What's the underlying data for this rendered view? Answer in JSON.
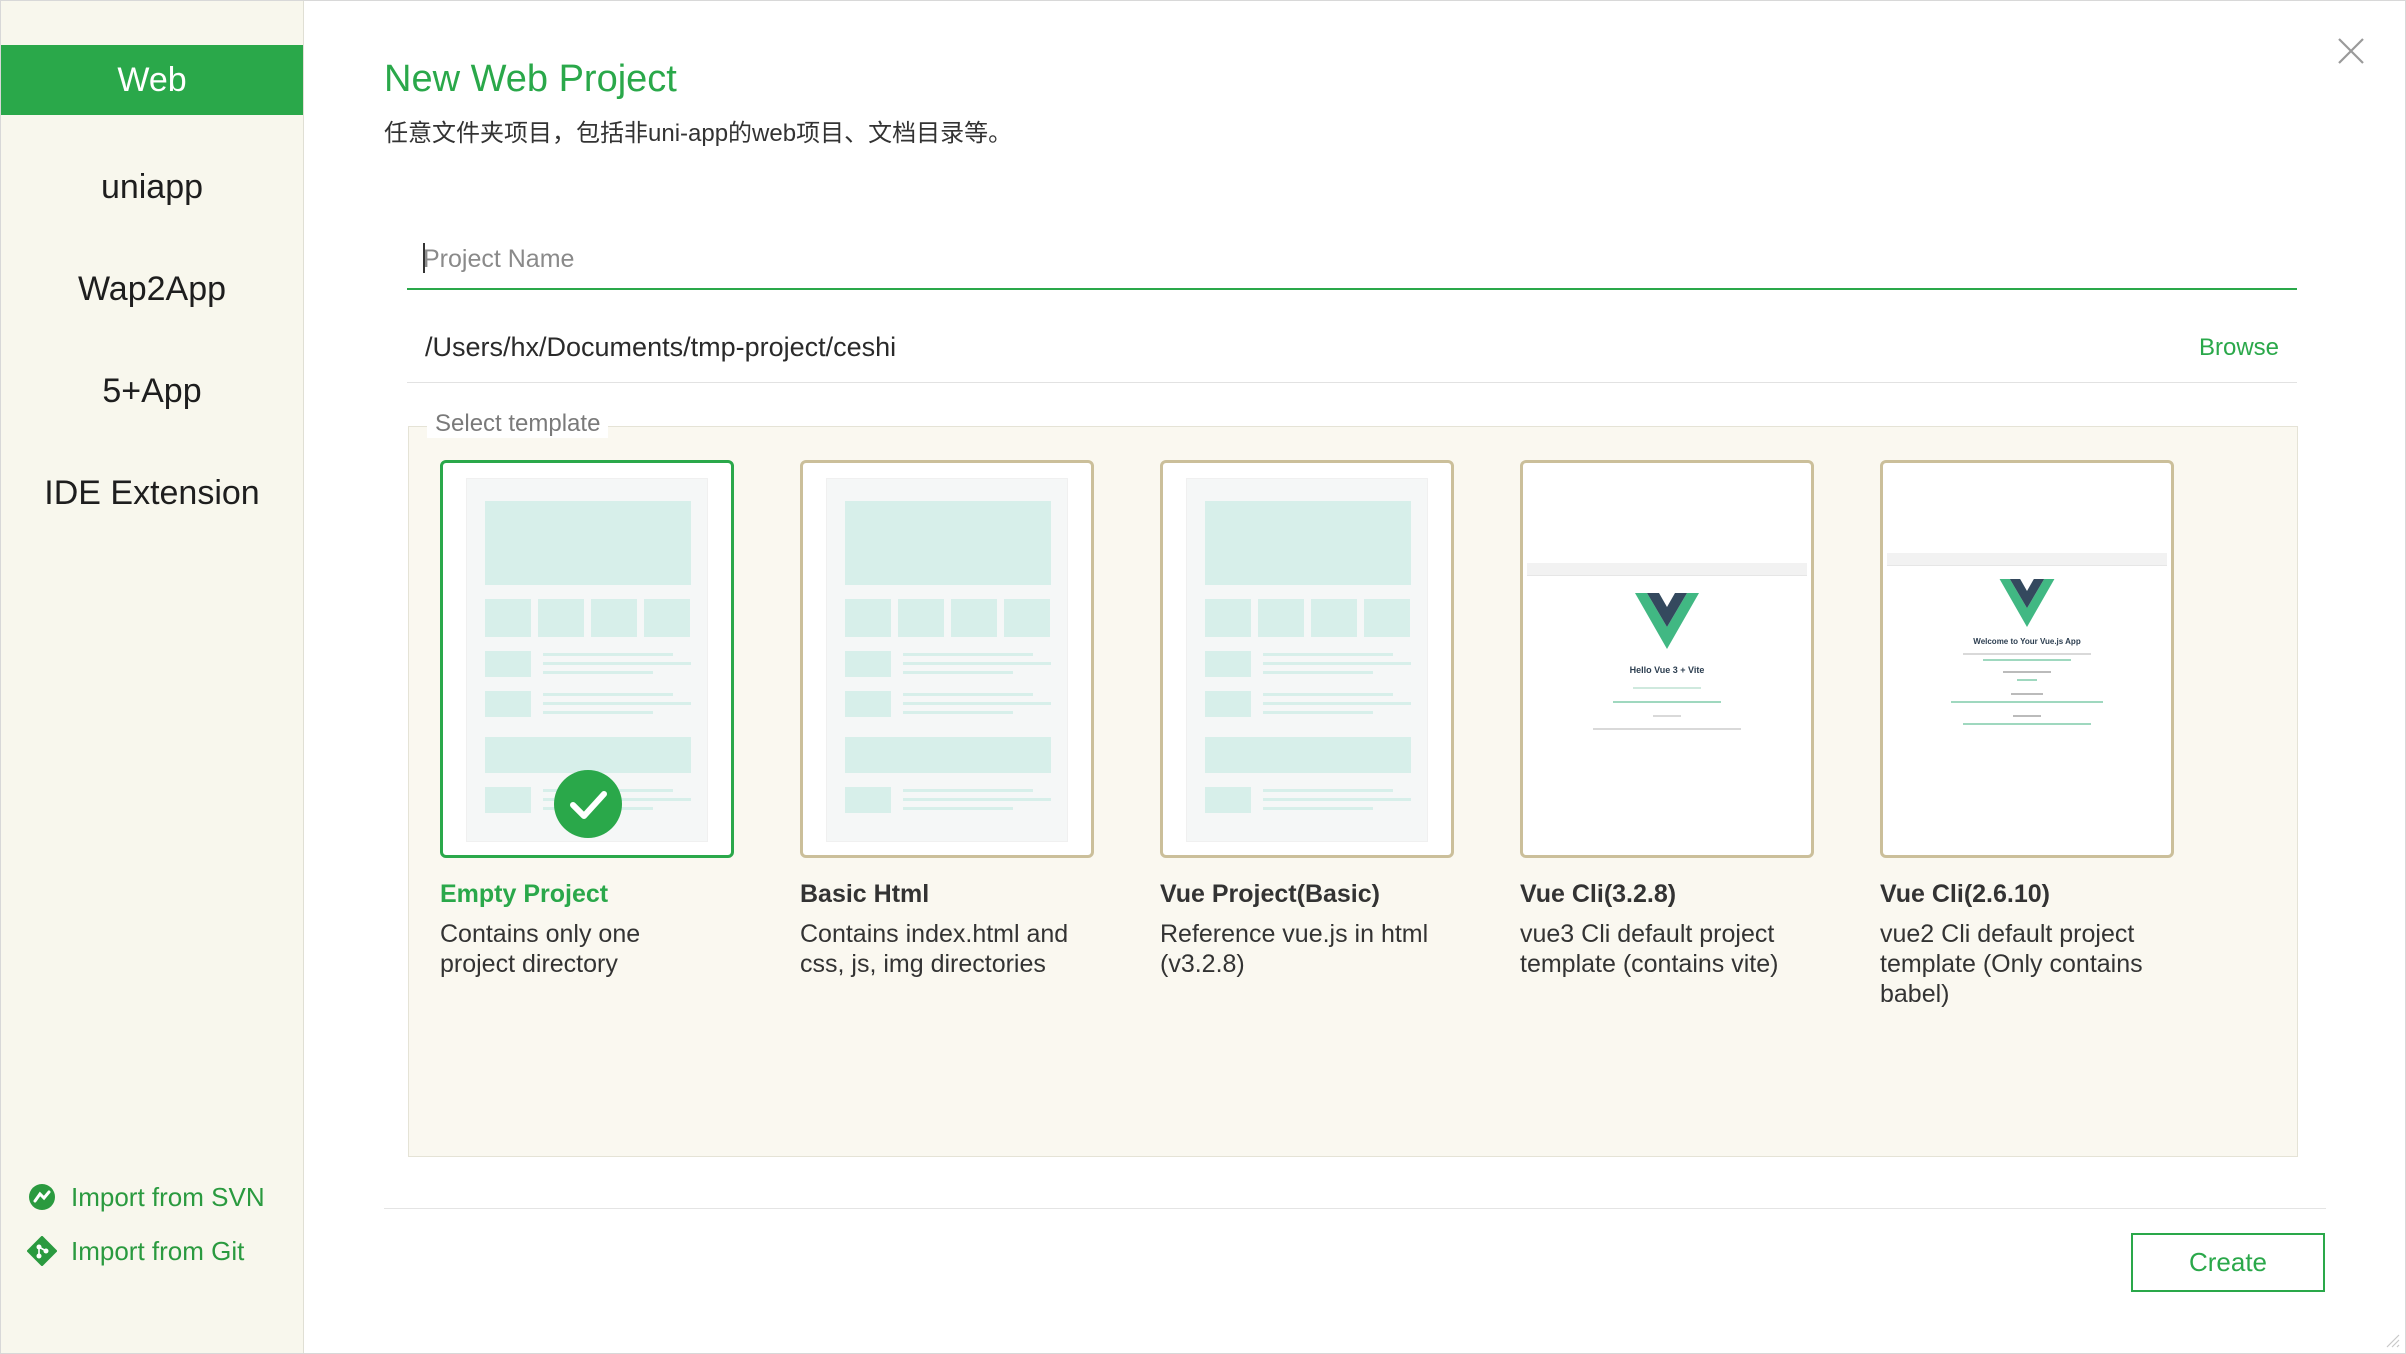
{
  "sidebar": {
    "items": [
      {
        "label": "Web",
        "active": true
      },
      {
        "label": "uniapp",
        "active": false
      },
      {
        "label": "Wap2App",
        "active": false
      },
      {
        "label": "5+App",
        "active": false
      },
      {
        "label": "IDE Extension",
        "active": false
      }
    ],
    "import_svn": "Import from SVN",
    "import_git": "Import from Git"
  },
  "header": {
    "title": "New Web Project",
    "subtitle": "任意文件夹项目，包括非uni-app的web项目、文档目录等。"
  },
  "form": {
    "name_placeholder": "Project Name",
    "name_value": "",
    "path": "/Users/hx/Documents/tmp-project/ceshi",
    "browse_label": "Browse"
  },
  "templates": {
    "legend": "Select template",
    "items": [
      {
        "title": "Empty Project",
        "desc": "Contains only one project directory",
        "selected": true,
        "icon": "layout-sheet"
      },
      {
        "title": "Basic Html",
        "desc": "Contains index.html and css, js, img directories",
        "selected": false,
        "icon": "layout-sheet"
      },
      {
        "title": "Vue Project(Basic)",
        "desc": "Reference vue.js in html (v3.2.8)",
        "selected": false,
        "icon": "layout-sheet"
      },
      {
        "title": "Vue Cli(3.2.8)",
        "desc": "vue3 Cli default project template (contains vite)",
        "selected": false,
        "icon": "vue-logo",
        "shot_heading": "Hello Vue 3 + Vite"
      },
      {
        "title": "Vue Cli(2.6.10)",
        "desc": "vue2 Cli default project template (Only contains babel)",
        "selected": false,
        "icon": "vue-logo",
        "shot_heading": "Welcome to Your Vue.js App"
      }
    ]
  },
  "footer": {
    "create_label": "Create"
  },
  "colors": {
    "accent": "#2aa84a",
    "sidebar_bg": "#f8f7ed",
    "card_border": "#cbbf9a",
    "thumb_fill": "#d7efea",
    "vue_green": "#41b883",
    "vue_dark": "#34495e"
  }
}
